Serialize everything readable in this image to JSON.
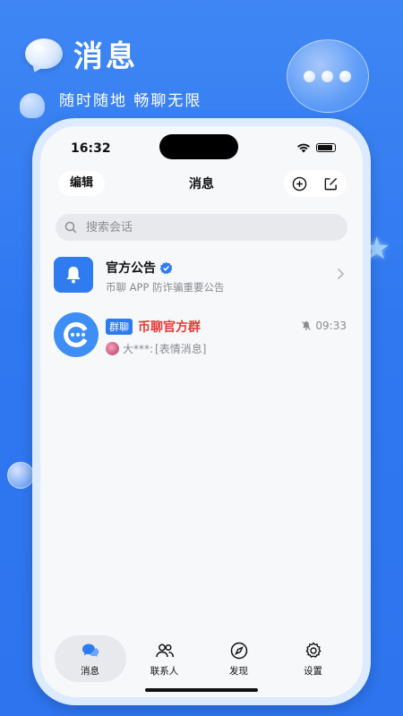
{
  "promo": {
    "title": "消息",
    "subtitle": "随时随地 畅聊无限"
  },
  "status_bar": {
    "time": "16:32",
    "icons": [
      "wifi-icon",
      "battery-icon"
    ]
  },
  "nav": {
    "edit_label": "编辑",
    "title": "消息",
    "actions": [
      "add-circle-icon",
      "compose-icon"
    ]
  },
  "search": {
    "placeholder": "搜索会话"
  },
  "conversations": [
    {
      "title": "官方公告",
      "verified": true,
      "subtitle": "币聊 APP 防诈骗重要公告",
      "icon": "bell-icon"
    },
    {
      "tag": "群聊",
      "title": "币聊官方群",
      "time": "09:33",
      "muted": true,
      "sender": "大***:",
      "last_message": "[表情消息]",
      "icon": "chat-logo-icon"
    }
  ],
  "tabs": [
    {
      "label": "消息",
      "icon": "chat-icon",
      "active": true
    },
    {
      "label": "联系人",
      "icon": "contacts-icon",
      "active": false
    },
    {
      "label": "发现",
      "icon": "compass-icon",
      "active": false
    },
    {
      "label": "设置",
      "icon": "settings-icon",
      "active": false
    }
  ],
  "colors": {
    "background": "#3f86f4",
    "accent": "#2f7bf0",
    "group_title": "#e53935"
  }
}
